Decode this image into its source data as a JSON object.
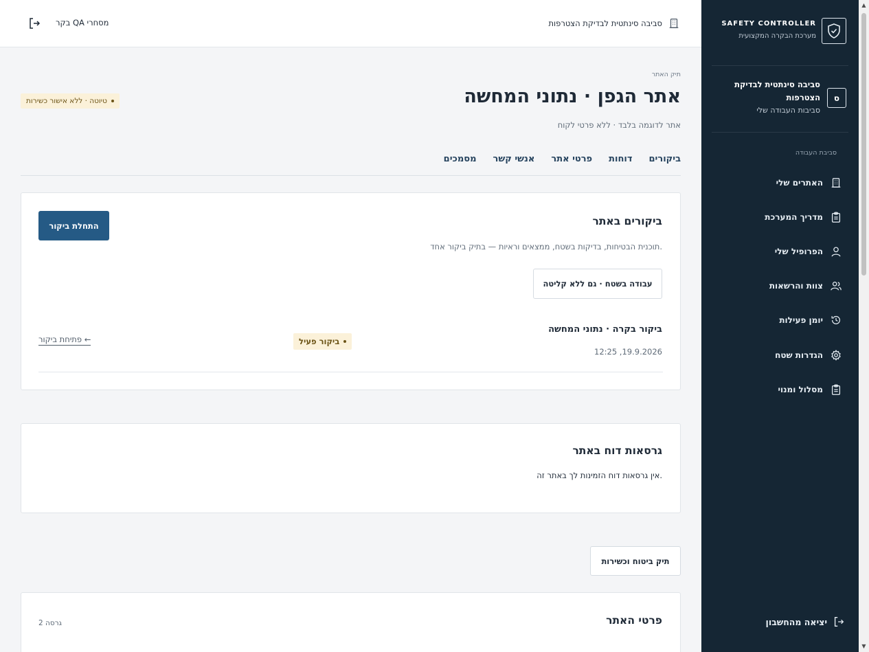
{
  "sidebar": {
    "brand_title": "SAFETY CONTROLLER",
    "brand_subtitle": "מערכת הבקרה המקצועית",
    "workspace_badge": "ס",
    "workspace_name": "סביבה סינתטית לבדיקת הצטרפות",
    "workspace_sub": "סביבות העבודה שלי",
    "section_label": "סביבת העבודה",
    "items": [
      {
        "label": "האתרים שלי",
        "icon": "building-icon"
      },
      {
        "label": "מדריך המערכת",
        "icon": "clipboard-icon"
      },
      {
        "label": "הפרופיל שלי",
        "icon": "user-icon"
      },
      {
        "label": "צוות והרשאות",
        "icon": "users-icon"
      },
      {
        "label": "יומן פעילות",
        "icon": "history-icon"
      },
      {
        "label": "הגדרות שטח",
        "icon": "gear-icon"
      },
      {
        "label": "מסלול ומנוי",
        "icon": "clipboard-icon"
      }
    ],
    "logout_label": "יציאה מהחשבון"
  },
  "topbar": {
    "environment": "סביבה סינתטית לבדיקת הצטרפות",
    "user": "בקר QA מסחרי"
  },
  "page": {
    "breadcrumb": "תיק האתר",
    "title": "אתר הגפן · נתוני המחשה",
    "subtitle": "אתר לדוגמה בלבד · ללא פרטי לקוח",
    "draft_badge": "טיוטה · ללא אישור כשירות",
    "tabs": [
      "ביקורים",
      "דוחות",
      "פרטי אתר",
      "אנשי קשר",
      "מסמכים"
    ]
  },
  "visits_card": {
    "title": "ביקורים באתר",
    "start_button": "התחלת ביקור",
    "description": "תוכנית הבטיחות, בדיקות בשטח, ממצאים וראיות — בתיק ביקור אחד.",
    "offline_button": "עבודה בשטח · גם ללא קליטה",
    "visit": {
      "title": "ביקור בקרה · נתוני המחשה",
      "date": "12:25 ,19.9.2026",
      "status": "ביקור פעיל",
      "open_link": "פתיחת ביקור ←"
    }
  },
  "reports_card": {
    "title": "גרסאות דוח באתר",
    "empty_text": "אין גרסאות דוח הזמינות לך באתר זה."
  },
  "insurance_button": "תיק ביטוח וכשירות",
  "details_card": {
    "title": "פרטי האתר",
    "version": "גרסה 2"
  },
  "colors": {
    "sidebar_bg": "#152634",
    "primary": "#255a85",
    "badge_bg": "#fbf1d9",
    "page_bg": "#f4f5f7"
  }
}
